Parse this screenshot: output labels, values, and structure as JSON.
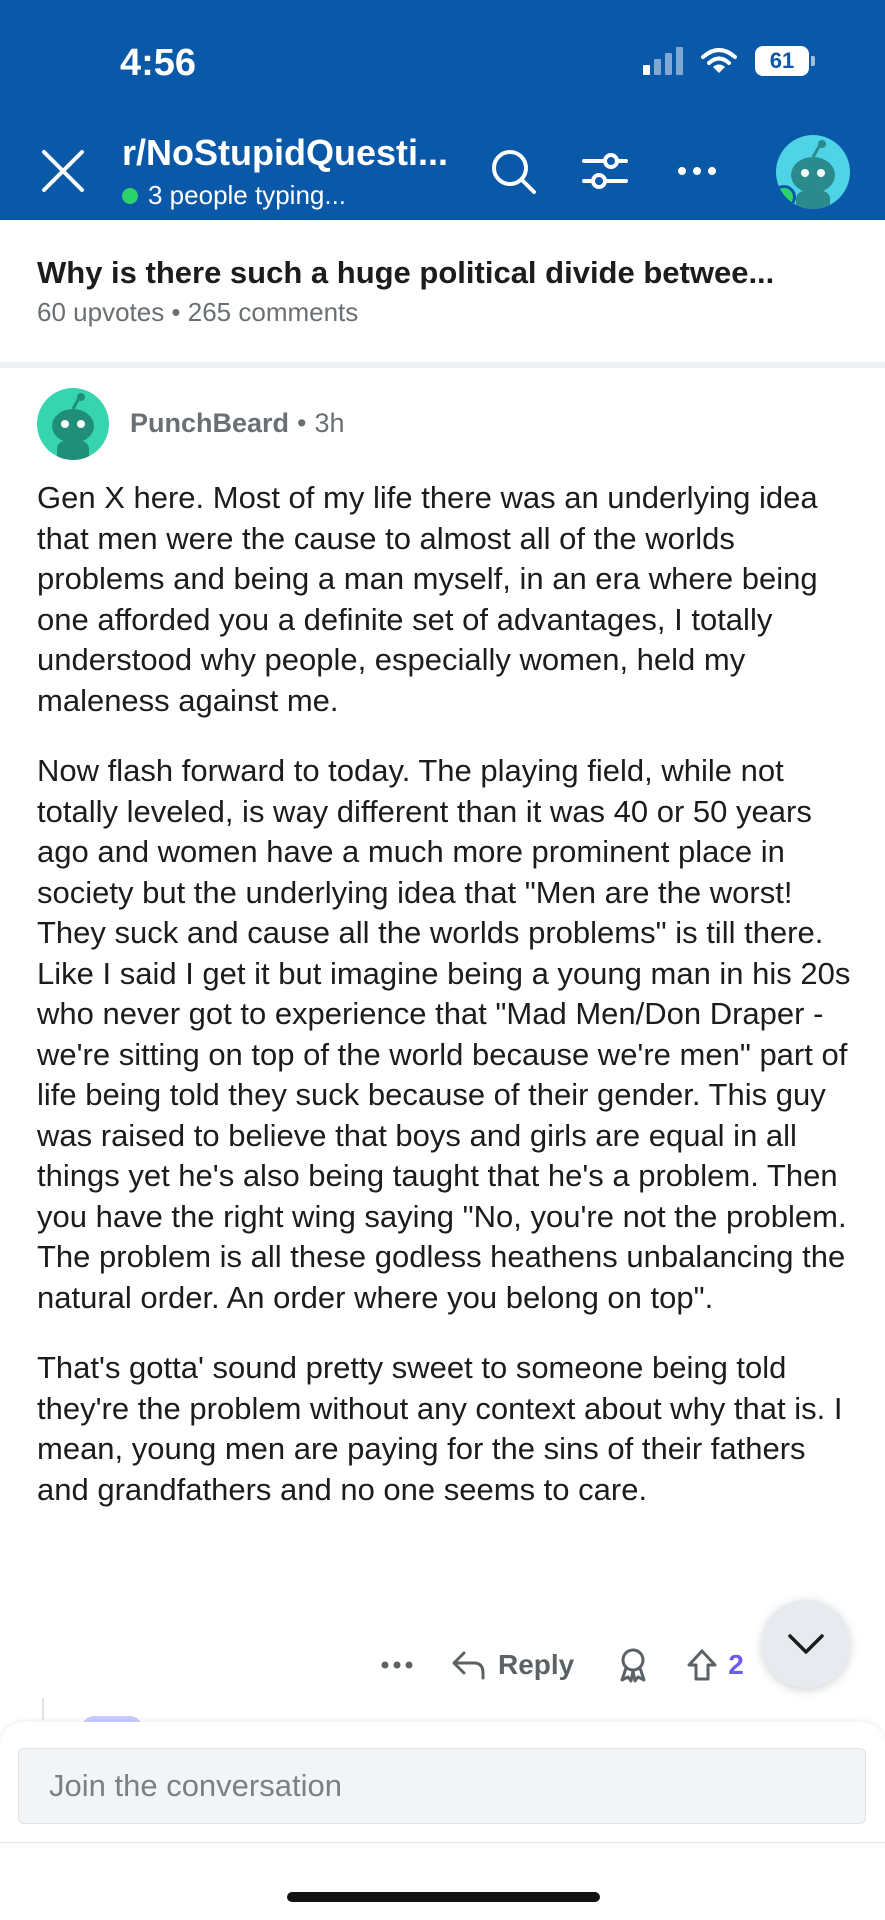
{
  "status_bar": {
    "time": "4:56",
    "battery": "61"
  },
  "header": {
    "subreddit": "r/NoStupidQuesti...",
    "typing_status": "3 people typing..."
  },
  "post": {
    "title": "Why is there such a huge political divide betwee...",
    "meta": "60 upvotes • 265 comments"
  },
  "comment": {
    "author": "PunchBeard",
    "separator": "•",
    "age": "3h",
    "paragraphs": [
      "Gen X here. Most of my life there was an underlying idea that men were the cause to almost all of the worlds problems and being a man myself, in an era where being one afforded you a definite set of advantages, I totally understood why people, especially women, held my maleness against me.",
      "Now flash forward to today. The playing field, while not totally leveled, is way different than it was 40 or 50 years ago and women have a much more prominent place in society but the underlying idea that \"Men are the worst! They suck and cause all the worlds problems\" is till there. Like I said I get it but imagine being a young man in his 20s who never got to experience that \"Mad Men/Don Draper - we're sitting on top of the world because we're men\" part of life being told they suck because of their gender. This guy was raised to believe that boys and girls are equal in all things yet he's also being taught that he's a problem. Then you have the right wing saying \"No, you're not the problem. The problem is all these godless heathens unbalancing the natural order. An order where you belong on top\".",
      "That's gotta' sound pretty sweet to someone being told they're the problem without any context about why that is. I mean, young men are paying for the sins of their fathers and grandfathers and no one seems to care."
    ],
    "reply_label": "Reply",
    "vote_count_visible": "2"
  },
  "composer": {
    "placeholder": "Join the conversation"
  },
  "colors": {
    "header_bg": "#0a59a8",
    "online_green": "#2bd36a",
    "vote_purple": "#6b5cf6",
    "text_primary": "#1c1c1c",
    "text_secondary": "#6a6f73"
  },
  "icons": [
    "close-icon",
    "search-icon",
    "filter-icon",
    "more-icon",
    "reply-icon",
    "award-icon",
    "upvote-icon",
    "chevron-down-icon"
  ]
}
